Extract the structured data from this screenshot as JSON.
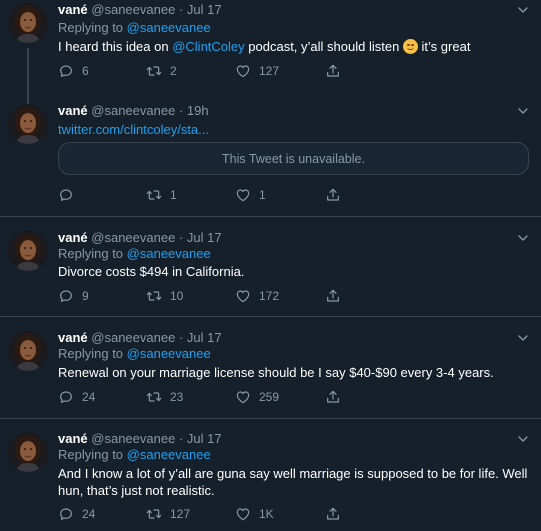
{
  "tweets": [
    {
      "name": "vané",
      "handle": "@saneevanee",
      "time": "Jul 17",
      "replying_label": "Replying to",
      "replying_to": "@saneevanee",
      "text_parts": [
        "I heard this idea on ",
        "@ClintColey",
        " podcast, y’all should listen ",
        " it’s great"
      ],
      "emoji": "smiling-face-emoji",
      "replies": "6",
      "retweets": "2",
      "likes": "127"
    },
    {
      "name": "vané",
      "handle": "@saneevanee",
      "time": "19h",
      "link": "twitter.com/clintcoley/sta...",
      "quote_text": "This Tweet is unavailable.",
      "replies": "",
      "retweets": "1",
      "likes": "1"
    },
    {
      "name": "vané",
      "handle": "@saneevanee",
      "time": "Jul 17",
      "replying_label": "Replying to",
      "replying_to": "@saneevanee",
      "text": "Divorce costs $494 in California.",
      "replies": "9",
      "retweets": "10",
      "likes": "172"
    },
    {
      "name": "vané",
      "handle": "@saneevanee",
      "time": "Jul 17",
      "replying_label": "Replying to",
      "replying_to": "@saneevanee",
      "text": "Renewal on your marriage license should be I say $40-$90 every 3-4 years.",
      "replies": "24",
      "retweets": "23",
      "likes": "259"
    },
    {
      "name": "vané",
      "handle": "@saneevanee",
      "time": "Jul 17",
      "replying_label": "Replying to",
      "replying_to": "@saneevanee",
      "text_lines": [
        "And I know a lot of y’all are guna say well marriage is supposed to be for life. Well",
        "hun, that’s just not realistic."
      ],
      "replies": "24",
      "retweets": "127",
      "likes": "1K"
    }
  ],
  "dot": "·",
  "colors": {
    "background": "#15202b",
    "accent": "#1da1f2",
    "secondary_text": "#8899a6",
    "divider": "#38444d"
  },
  "icons": [
    "avatar",
    "chevron-down-icon",
    "reply-icon",
    "retweet-icon",
    "like-icon",
    "share-icon"
  ]
}
